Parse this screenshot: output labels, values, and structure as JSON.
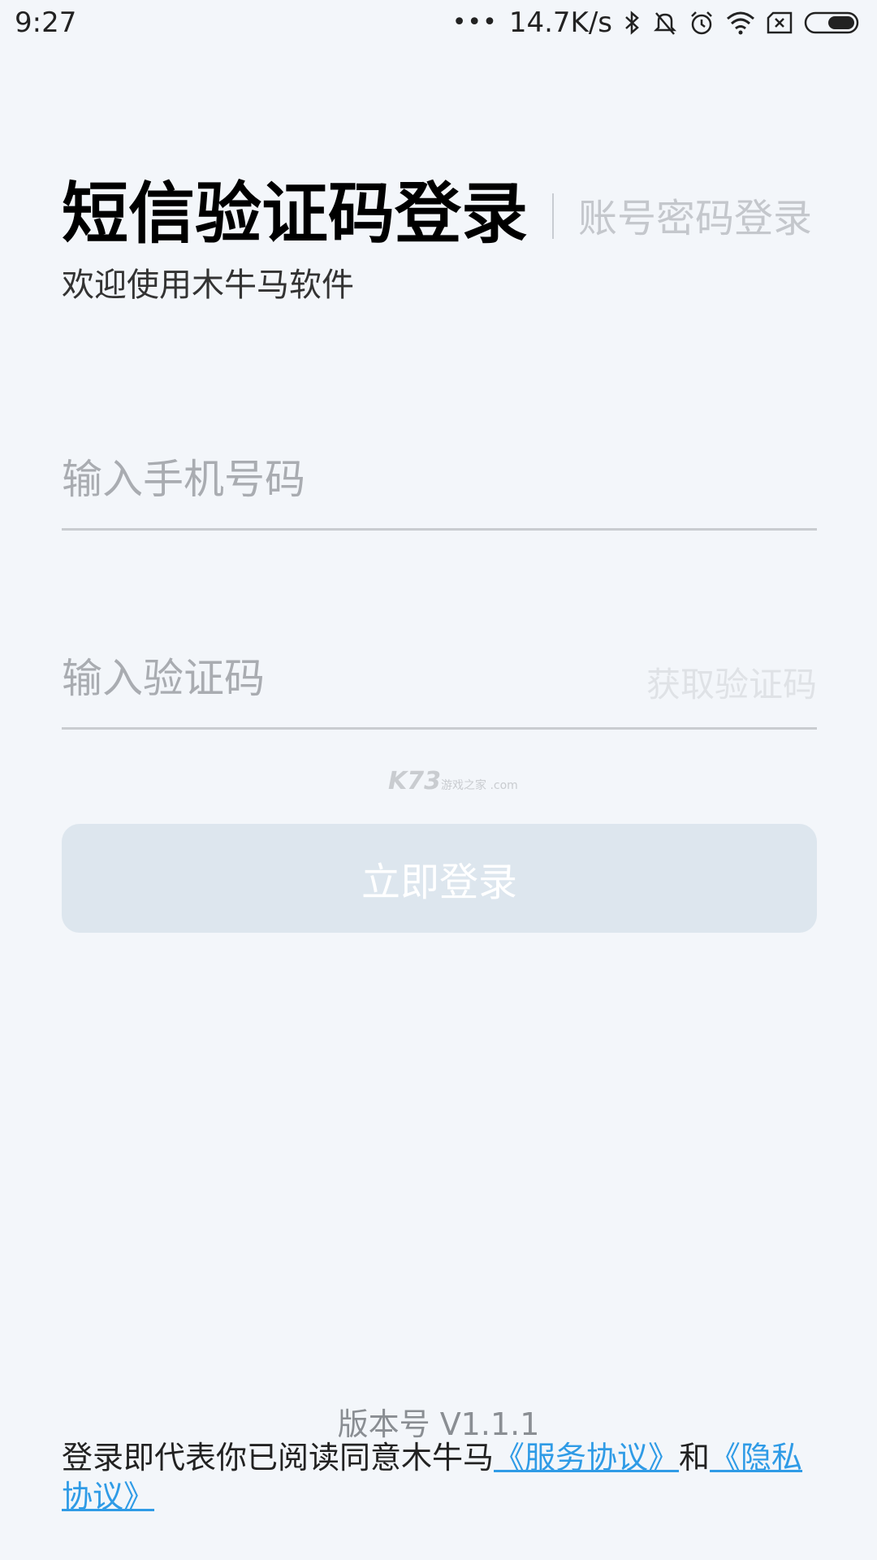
{
  "status_bar": {
    "time": "9:27",
    "dots": "•••",
    "network_speed": "14.7K/s",
    "icons": [
      "bluetooth-icon",
      "bell-muted-icon",
      "alarm-icon",
      "wifi-icon",
      "sim-none-icon",
      "battery-icon"
    ]
  },
  "header": {
    "title": "短信验证码登录",
    "alt_login": "账号密码登录",
    "subtitle": "欢迎使用木牛马软件"
  },
  "form": {
    "phone_placeholder": "输入手机号码",
    "phone_value": "",
    "code_placeholder": "输入验证码",
    "code_value": "",
    "get_code_label": "获取验证码",
    "login_label": "立即登录"
  },
  "watermark": {
    "main": "K73",
    "sub": "游戏之家 .com"
  },
  "footer": {
    "version": "版本号 V1.1.1",
    "agreement_prefix": "登录即代表你已阅读同意木牛马",
    "service_link": "《服务协议》",
    "and": "和",
    "privacy_link": "《隐私协议》"
  },
  "colors": {
    "background": "#f3f6fa",
    "link": "#2f9be6",
    "button_disabled": "#dde6ee"
  }
}
